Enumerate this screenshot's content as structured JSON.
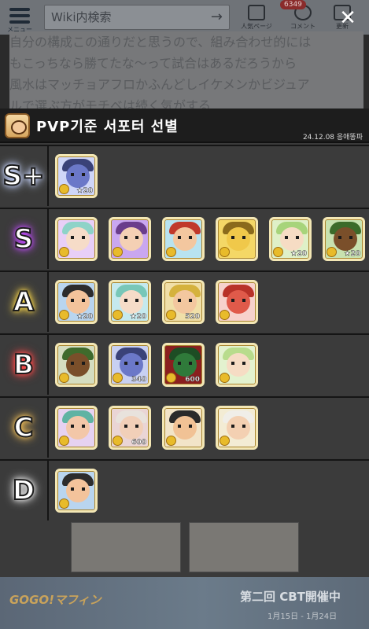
{
  "header": {
    "menu_label": "メニュー",
    "search_placeholder": "Wiki内検索",
    "popular_label": "人気ページ",
    "comment_label": "コメント",
    "edit_label": "更新",
    "comment_badge": "6349"
  },
  "background_text": [
    "自分の構成この通りだと思うので、組み合わせ的には",
    "もこっちなら勝てたな〜って試合はあるだろうから",
    "風水はマッチョアフロかふんどしイケメンかビジュア",
    "ルで選ぶ方がモチベは続く気がする"
  ],
  "card": {
    "title": "PVP기준 서포터 선별",
    "date": "24.12.08 응애똥파",
    "tiers": [
      {
        "label": "S+",
        "glow": "#c9d6ff",
        "characters": [
          {
            "name": "blue-oni",
            "level": "20",
            "bg": "#cfd6f8",
            "face": "#6b78c8",
            "hair": "#3a4278",
            "stars": 1
          }
        ]
      },
      {
        "label": "S",
        "glow": "#c34dff",
        "characters": [
          {
            "name": "green-hair-girl",
            "level": "",
            "bg": "#e8cff7",
            "face": "#f6dcc8",
            "hair": "#8ed3c8"
          },
          {
            "name": "purple-hood",
            "level": "",
            "bg": "#c9a7f0",
            "face": "#f4d0b4",
            "hair": "#6a3d8c"
          },
          {
            "name": "laughing-man",
            "level": "",
            "bg": "#b8e3f0",
            "face": "#f3c79f",
            "hair": "#c0392b"
          },
          {
            "name": "yellow-cat",
            "level": "",
            "bg": "#f4d766",
            "face": "#f0c84a",
            "hair": "#8a6a1c"
          },
          {
            "name": "green-hair-boy",
            "level": "20",
            "bg": "#dff0c8",
            "face": "#f6dcc4",
            "hair": "#a7d47b",
            "stars": 1
          },
          {
            "name": "bush-creature",
            "level": "20",
            "bg": "#c8e2b0",
            "face": "#7a4f2a",
            "hair": "#3c6b2a",
            "stars": 1
          }
        ]
      },
      {
        "label": "A",
        "glow": "#f5d34a",
        "characters": [
          {
            "name": "bald-beard-man",
            "level": "20",
            "bg": "#b9d5ef",
            "face": "#f3c39b",
            "hair": "#2c2c2c",
            "stars": 1
          },
          {
            "name": "green-hair-kid",
            "level": "20",
            "bg": "#c5e9ee",
            "face": "#f6dcc8",
            "hair": "#78c7b8",
            "stars": 1
          },
          {
            "name": "helmet-soldier",
            "level": "520",
            "bg": "#f0dfa8",
            "face": "#f3c79f",
            "hair": "#d5b23d"
          },
          {
            "name": "red-creature",
            "level": "",
            "bg": "#f7d2cc",
            "face": "#e05a4a",
            "hair": "#b83228"
          }
        ]
      },
      {
        "label": "B",
        "glow": "#ff4a4a",
        "characters": [
          {
            "name": "bush-boar",
            "level": "",
            "bg": "#d5ddc0",
            "face": "#7a4f2a",
            "hair": "#3f6b2c"
          },
          {
            "name": "blue-oni-2",
            "level": "340",
            "bg": "#c8d0f2",
            "face": "#6b78c8",
            "hair": "#3a4278"
          },
          {
            "name": "green-plant",
            "level": "600",
            "bg": "#8a1f1f",
            "face": "#2f7a3a",
            "hair": "#1d4d24"
          },
          {
            "name": "blonde-boy",
            "level": "",
            "bg": "#e3f2cf",
            "face": "#f6dcc4",
            "hair": "#b8dc8c"
          }
        ]
      },
      {
        "label": "C",
        "glow": "#f6c35a",
        "characters": [
          {
            "name": "green-beard-man",
            "level": "",
            "bg": "#e6d2f1",
            "face": "#f3c7a8",
            "hair": "#5fb3a3"
          },
          {
            "name": "old-man-hat",
            "level": "600",
            "bg": "#ead5d5",
            "face": "#f1cfb8",
            "hair": "#e8e2dc"
          },
          {
            "name": "mustache-man",
            "level": "",
            "bg": "#f2e4c8",
            "face": "#f1c295",
            "hair": "#2a2a2a"
          },
          {
            "name": "white-beard-elder",
            "level": "",
            "bg": "#f3ecd4",
            "face": "#f3d0b2",
            "hair": "#f0eee8"
          }
        ]
      },
      {
        "label": "D",
        "glow": "#e0e0e0",
        "characters": [
          {
            "name": "bald-beard-man-2",
            "level": "",
            "bg": "#b9d5ef",
            "face": "#f3c39b",
            "hair": "#2c2c2c"
          }
        ]
      }
    ]
  },
  "banner": {
    "logo": "GOGO!マフィン",
    "title": "第二回 CBT開催中",
    "subtitle": "1月15日 - 1月24日"
  }
}
